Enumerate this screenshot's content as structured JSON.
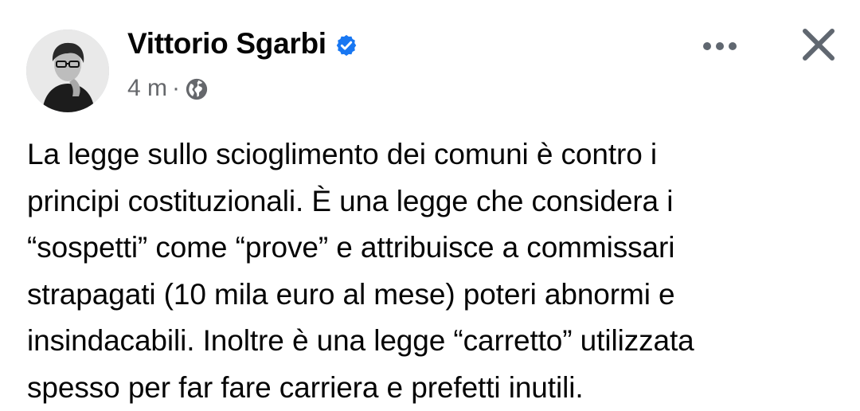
{
  "post": {
    "author": "Vittorio Sgarbi",
    "timestamp": "4 m",
    "separator": "·",
    "privacy_icon": "globe-icon",
    "verified_icon": "verified-badge-icon",
    "text": "La legge sullo scioglimento dei comuni è contro i\nprincipi costituzionali.  È una legge che considera i\n“sospetti” come “prove” e attribuisce a commissari\nstrapagati (10 mila euro al mese) poteri abnormi e\ninsindacabili. Inoltre è una legge “carretto” utilizzata\nspesso per far fare carriera e prefetti inutili."
  },
  "actions": {
    "more_icon": "more-options-icon",
    "close_icon": "close-icon"
  },
  "colors": {
    "verified_blue": "#1877f2",
    "secondary_text": "#65676b",
    "primary_text": "#050505"
  }
}
